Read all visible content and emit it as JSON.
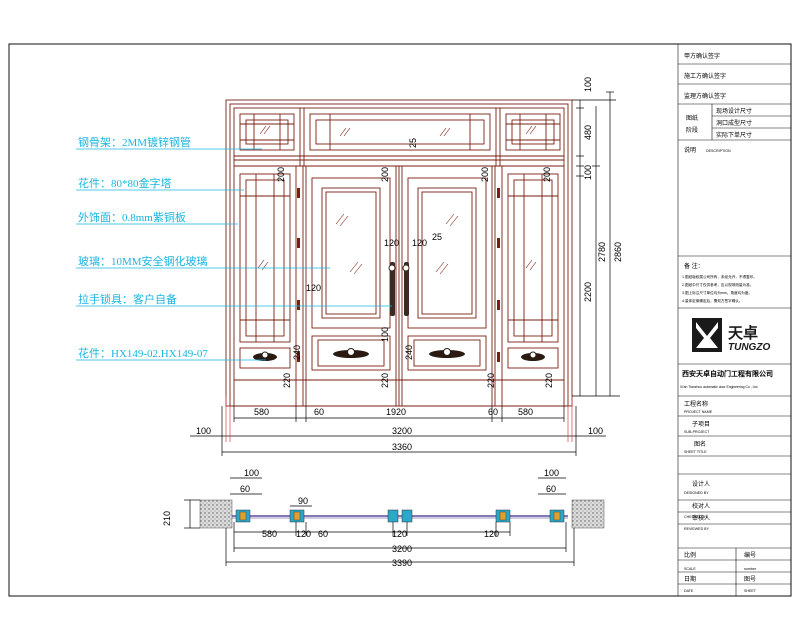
{
  "colors": {
    "frame": "#111111",
    "door": "#7a1e12",
    "dimension": "#000000",
    "annotation": "#19b6e0",
    "extension": "#d94040",
    "section_glass": "#3a2a8a",
    "section_fill": "#2aa7c9"
  },
  "annotations": [
    "钢骨架：2MM镀锌钢管",
    "花件：80*80金字塔",
    "外饰面：0.8mm紫铜板",
    "玻璃：10MM安全钢化玻璃",
    "拉手锁具：客户自备",
    "花件：HX149-02.HX149-07"
  ],
  "elevation_dims": {
    "bottom_row": [
      "580",
      "60",
      "1920",
      "60",
      "580"
    ],
    "left_margin": "100",
    "right_margin": "100",
    "inner_width": "3200",
    "total_width": "3360",
    "right_heights": [
      "100",
      "480",
      "100",
      "2200",
      "2780",
      "2860"
    ],
    "transom_mid": "25",
    "panel_labels": [
      "200",
      "200",
      "200",
      "200",
      "120",
      "25",
      "120",
      "120",
      "100",
      "240",
      "240",
      "220",
      "220",
      "220",
      "220"
    ]
  },
  "section_dims": {
    "depth": "210",
    "top_left": [
      "100",
      "60",
      "90"
    ],
    "top_right": [
      "100",
      "60"
    ],
    "row": [
      "580",
      "60",
      "120",
      "120",
      "120"
    ],
    "inner_width": "3200",
    "total_width": "3390"
  },
  "title_block": {
    "sign_party_a": "甲方确认签字",
    "sign_construction": "施工方确认签字",
    "sign_supervision": "监理方确认签字",
    "drawing_stage": "图纸\n阶段",
    "stage_items": [
      "现场设计尺寸",
      "洞口成型尺寸",
      "实际下单尺寸"
    ],
    "description_label": "说明",
    "description_en": "DESCRIPTION",
    "remarks_label": "备    注：",
    "remarks": [
      "1.图纸版权属公司所有，未经允许，不得复印。",
      "2.图纸中尺寸仅供参考，应以现场测量为准。",
      "3.图上标注尺寸单位均为mm，角度均为度。",
      "4.量体定案确定后，需双方签字确认。"
    ],
    "logo_cn": "天卓",
    "logo_en": "TUNGZO",
    "company_cn": "西安天卓自动门工程有限公司",
    "company_en": "Xi'an Tianzhuo automatic door Engineering Co., Ltd.",
    "fields": [
      {
        "cn": "工程名称",
        "en": "PROJECT NAME"
      },
      {
        "cn": "子项目",
        "en": "SUB-PROJECT"
      },
      {
        "cn": "图名",
        "en": "SHEET TITLE"
      },
      {
        "cn": "设计人",
        "en": "DESIGNED BY"
      },
      {
        "cn": "校对人",
        "en": "CHECKED BY"
      },
      {
        "cn": "审核人",
        "en": "REVIEWED BY"
      }
    ],
    "scale_cn": "比例",
    "scale_en": "SCALE",
    "number_cn": "编号",
    "number_en": "number",
    "date_cn": "日期",
    "date_en": "DATE",
    "sheet_cn": "图号",
    "sheet_en": "SHEET"
  }
}
